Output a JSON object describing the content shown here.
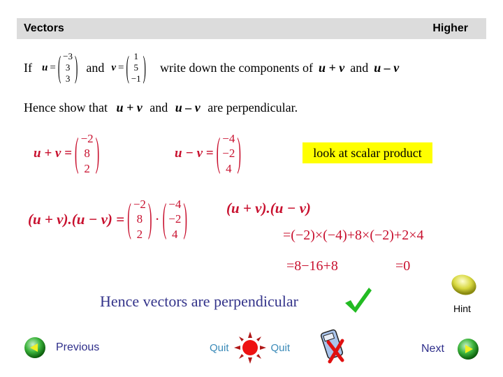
{
  "header": {
    "title": "Vectors",
    "level": "Higher"
  },
  "question": {
    "line1": {
      "if": "If",
      "u_label": "u",
      "u": [
        "−3",
        "3",
        "3"
      ],
      "and": "and",
      "v_label": "v",
      "v": [
        "1",
        "5",
        "−1"
      ],
      "text": "write down the components of",
      "expr1": "u + v",
      "and2": "and",
      "expr2": "u – v"
    },
    "line2": {
      "text": "Hence show that",
      "expr1": "u + v",
      "and": "and",
      "expr2": "u – v",
      "tail": "are perpendicular."
    }
  },
  "answer": {
    "sum_label": "u + v =",
    "sum": [
      "−2",
      "8",
      "2"
    ],
    "diff_label": "u − v =",
    "diff": [
      "−4",
      "−2",
      "4"
    ],
    "tip": "look at scalar product",
    "dot_label": "(u + v).(u − v) =",
    "dot_head": "(u + v).(u − v)",
    "dot_step1": "=(−2)×(−4)+8×(−2)+2×4",
    "dot_step2": "=8−16+8",
    "dot_result": "=0",
    "conclusion": "Hence vectors are perpendicular"
  },
  "nav": {
    "hint": "Hint",
    "previous": "Previous",
    "quit_left": "Quit",
    "quit_right": "Quit",
    "next": "Next"
  },
  "colors": {
    "math": "#c8102e",
    "conclusion": "#33338a",
    "tip_bg": "#ffff00",
    "check": "#22bb22"
  }
}
